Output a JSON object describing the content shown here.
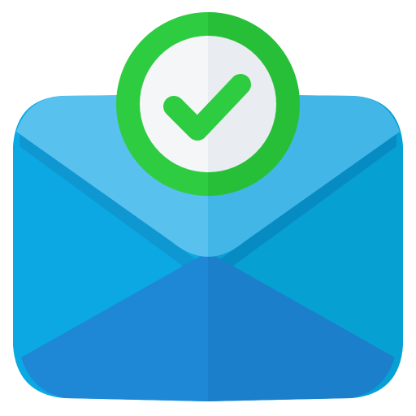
{
  "icon": {
    "name": "mail-verified-icon",
    "parts": {
      "envelope": "envelope-icon",
      "badge": "check-badge-icon",
      "check": "checkmark-icon"
    }
  },
  "colors": {
    "envelope_left": "#0BA8E3",
    "envelope_right": "#07A0D3",
    "envelope_left_dark": "#0F97D2",
    "envelope_right_dark": "#078BC3",
    "bottom_flap_left": "#1E88D6",
    "bottom_flap_right": "#1C7FCB",
    "top_flap_left": "#58C1EE",
    "top_flap_right": "#43B6E8",
    "badge_ring": "#2ECC40",
    "badge_ring_right": "#27BF38",
    "badge_inner_left": "#F5F6F8",
    "badge_inner_right": "#E9ECF1",
    "check": "#2ECC40"
  }
}
